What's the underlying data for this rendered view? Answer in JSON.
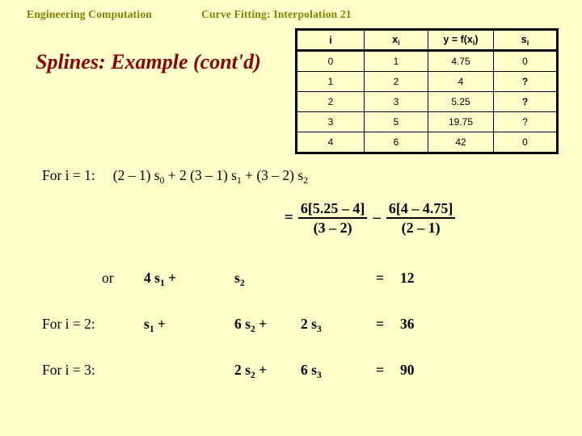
{
  "header": {
    "left": "Engineering Computation",
    "right": "Curve Fitting: Interpolation 21"
  },
  "title": "Splines: Example (cont'd)",
  "colors": {
    "background": "#ffffcc",
    "header_text": "#808000",
    "title_text": "#8b0000",
    "body_text": "#000000",
    "table_border": "#000000"
  },
  "table": {
    "headers": [
      "i",
      "x",
      "y  =  f(x",
      "s"
    ],
    "header_display": {
      "col1": "i",
      "col2_base": "x",
      "col2_sub": "i",
      "col3_a": "y  =  f(x",
      "col3_sub": "i",
      "col3_b": ")",
      "col4_base": "s",
      "col4_sub": "i"
    },
    "rows": [
      {
        "i": "0",
        "x": "1",
        "y": "4.75",
        "s": "0",
        "s_bold": false
      },
      {
        "i": "1",
        "x": "2",
        "y": "4",
        "s": "?",
        "s_bold": true
      },
      {
        "i": "2",
        "x": "3",
        "y": "5.25",
        "s": "?",
        "s_bold": true
      },
      {
        "i": "3",
        "x": "5",
        "y": "19.75",
        "s": "?",
        "s_bold": false
      },
      {
        "i": "4",
        "x": "6",
        "y": "42",
        "s": "0",
        "s_bold": false
      }
    ]
  },
  "equation_i1": {
    "label": "For i = 1:",
    "expr_a": "(2 – 1) s",
    "expr_a_sub": "0",
    "expr_b": " + 2 (3 – 1) s",
    "expr_b_sub": "1",
    "expr_c": " + (3 – 2) s",
    "expr_c_sub": "2"
  },
  "fraction": {
    "equals": "=",
    "term1_numerator": "6[5.25 – 4]",
    "term1_denominator": "(3 – 2)",
    "operator": "–",
    "term2_numerator": "6[4 – 4.75]",
    "term2_denominator": "(2 – 1)"
  },
  "equations": [
    {
      "label": "or",
      "is_or": true,
      "term1_coef": "4 s",
      "term1_sub": "1",
      "plus1": "+",
      "term2_coef": "s",
      "term2_sub": "2",
      "plus2": "",
      "term3_coef": "",
      "term3_sub": "",
      "equals": "=",
      "rhs": "12"
    },
    {
      "label": "For i = 2:",
      "is_or": false,
      "term1_coef": "s",
      "term1_sub": "1",
      "plus1": "+",
      "term2_coef": "6 s",
      "term2_sub": "2",
      "plus2": "+",
      "term3_coef": "2 s",
      "term3_sub": "3",
      "equals": "=",
      "rhs": "36"
    },
    {
      "label": "For i = 3:",
      "is_or": false,
      "term1_coef": "",
      "term1_sub": "",
      "plus1": "",
      "term2_coef": "2 s",
      "term2_sub": "2",
      "plus2": "+",
      "term3_coef": "6 s",
      "term3_sub": "3",
      "equals": "=",
      "rhs": "90"
    }
  ]
}
